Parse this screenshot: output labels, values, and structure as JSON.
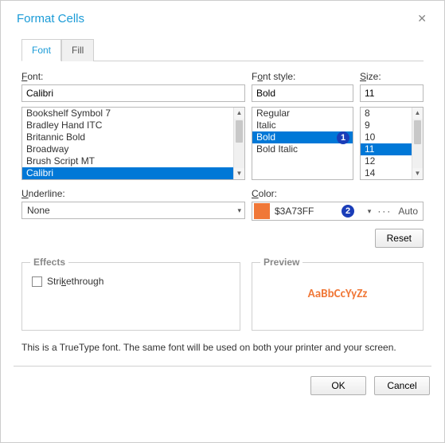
{
  "dialog": {
    "title": "Format Cells",
    "close_glyph": "✕"
  },
  "tabs": {
    "font": "Font",
    "fill": "Fill"
  },
  "labels": {
    "font": "Font:",
    "style": "Font style:",
    "size": "Size:",
    "underline": "Underline:",
    "color": "Color:",
    "effects": "Effects",
    "preview": "Preview",
    "strike": "Strikethrough"
  },
  "font": {
    "value": "Calibri",
    "items": [
      "Bookshelf Symbol 7",
      "Bradley Hand ITC",
      "Britannic Bold",
      "Broadway",
      "Brush Script MT",
      "Calibri"
    ],
    "selected": "Calibri"
  },
  "style": {
    "value": "Bold",
    "items": [
      "Regular",
      "Italic",
      "Bold",
      "Bold Italic"
    ],
    "selected": "Bold"
  },
  "size": {
    "value": "11",
    "items": [
      "8",
      "9",
      "10",
      "11",
      "12",
      "14"
    ],
    "selected": "11"
  },
  "underline": {
    "value": "None"
  },
  "color": {
    "hex": "$3A73FF",
    "swatch": "#f07838",
    "auto": "Auto",
    "more": "···"
  },
  "buttons": {
    "reset": "Reset",
    "ok": "OK",
    "cancel": "Cancel"
  },
  "preview": {
    "text": "AaBbCcYyZz"
  },
  "footer": {
    "note": "This is a TrueType font. The same font will be used on both your printer and your screen."
  },
  "callouts": {
    "one": "1",
    "two": "2"
  },
  "glyphs": {
    "up": "▲",
    "down": "▼",
    "drop": "▾"
  }
}
